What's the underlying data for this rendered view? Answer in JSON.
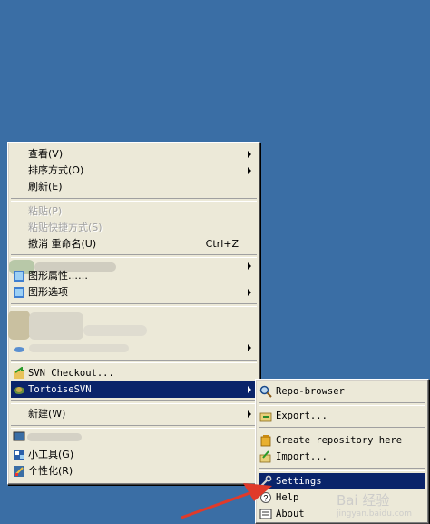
{
  "main_menu": {
    "view": "查看(V)",
    "sort": "排序方式(O)",
    "refresh": "刷新(E)",
    "paste": "粘贴(P)",
    "paste_shortcut": "粘贴快捷方式(S)",
    "undo_rename": "撤消 重命名(U)",
    "undo_shortcut": "Ctrl+Z",
    "graphics_props": "图形属性……",
    "graphics_options": "图形选项",
    "svn_checkout": "SVN Checkout...",
    "tortoise_svn": "TortoiseSVN",
    "new": "新建(W)",
    "gadgets": "小工具(G)",
    "personalize": "个性化(R)"
  },
  "submenu": {
    "repo_browser": "Repo-browser",
    "export": "Export...",
    "create_repo": "Create repository here",
    "import": "Import...",
    "settings": "Settings",
    "help": "Help",
    "about": "About"
  },
  "watermark": {
    "brand": "Bai 经验",
    "url": "jingyan.baidu.com"
  },
  "colors": {
    "desktop": "#3a6ea5",
    "menu": "#ece9d8",
    "highlight": "#0a246a",
    "arrow": "#e03a2a"
  }
}
